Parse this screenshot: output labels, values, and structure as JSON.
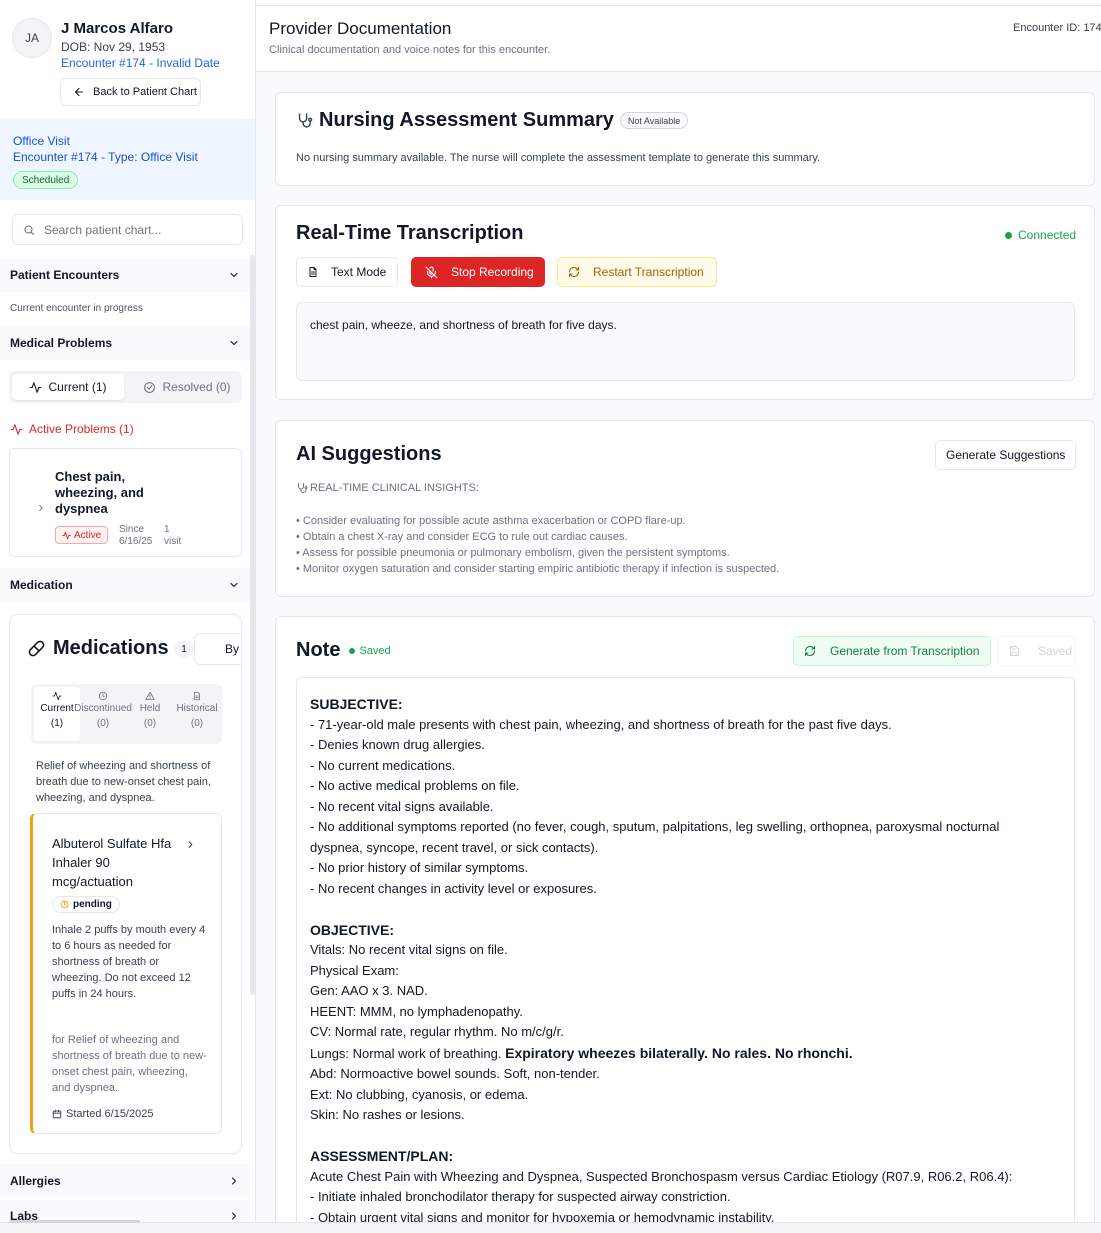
{
  "patient": {
    "initials": "JA",
    "name": "J Marcos Alfaro",
    "dob": "DOB: Nov 29, 1953",
    "encounter_link": "Encounter #174 - Invalid Date",
    "back_button": "Back to Patient Chart"
  },
  "visit": {
    "title": "Office Visit",
    "subtitle": "Encounter #174 - Type: Office Visit",
    "status": "Scheduled"
  },
  "search": {
    "placeholder": "Search patient chart..."
  },
  "sections": {
    "encounters": "Patient Encounters",
    "encounters_note": "Current encounter in progress",
    "problems": "Medical Problems",
    "medication": "Medication",
    "allergies": "Allergies",
    "labs": "Labs"
  },
  "problems": {
    "tab_current": "Current (1)",
    "tab_resolved": "Resolved (0)",
    "active_label": "Active Problems (1)",
    "item": {
      "title": "Chest pain, wheezing, and dyspnea",
      "status": "Active",
      "since_label": "Since",
      "since_date": "6/16/25",
      "visit_count": "1",
      "visit_label": "visit"
    }
  },
  "medications": {
    "title": "Medications",
    "count": "1",
    "group_button": "By M",
    "tabs": [
      {
        "label": "Current",
        "count": "(1)"
      },
      {
        "label": "Discontinued",
        "count": "(0)"
      },
      {
        "label": "Held",
        "count": "(0)"
      },
      {
        "label": "Historical",
        "count": "(0)"
      }
    ],
    "reason": "Relief of wheezing and shortness of breath due to new-onset chest pain, wheezing, and dyspnea.",
    "item": {
      "name": "Albuterol Sulfate Hfa Inhaler 90 mcg/actuation",
      "status": "pending",
      "sig": "Inhale 2 puffs by mouth every 4 to 6 hours as needed for shortness of breath or wheezing. Do not exceed 12 puffs in 24 hours.",
      "indication": "for Relief of wheezing and shortness of breath due to new-onset chest pain, wheezing, and dyspnea.",
      "started": "Started 6/15/2025"
    }
  },
  "header": {
    "title": "Provider Documentation",
    "subtitle": "Clinical documentation and voice notes for this encounter.",
    "encounter_id": "Encounter ID: 174"
  },
  "nursing": {
    "title": "Nursing Assessment Summary",
    "badge": "Not Available",
    "text": "No nursing summary available. The nurse will complete the assessment template to generate this summary."
  },
  "transcription": {
    "title": "Real-Time Transcription",
    "status": "Connected",
    "text_mode": "Text Mode",
    "stop": "Stop Recording",
    "restart": "Restart Transcription",
    "content": "chest pain, wheeze, and shortness of breath for five days."
  },
  "ai": {
    "title": "AI Suggestions",
    "button": "Generate Suggestions",
    "insights_header": "REAL-TIME CLINICAL INSIGHTS:",
    "items": [
      "• Consider evaluating for possible acute asthma exacerbation or COPD flare-up.",
      "• Obtain a chest X-ray and consider ECG to rule out cardiac causes.",
      "• Assess for possible pneumonia or pulmonary embolism, given the persistent symptoms.",
      "• Monitor oxygen saturation and consider starting empiric antibiotic therapy if infection is suspected."
    ]
  },
  "note": {
    "title": "Note",
    "saved_tag": "Saved",
    "generate": "Generate from Transcription",
    "saved_btn": "Saved",
    "subjective_h": "SUBJECTIVE:",
    "subjective": [
      "- 71-year-old male presents with chest pain, wheezing, and shortness of breath for the past five days.",
      "- Denies known drug allergies.",
      "- No current medications.",
      "- No active medical problems on file.",
      "- No recent vital signs available.",
      "- No additional symptoms reported (no fever, cough, sputum, palpitations, leg swelling, orthopnea, paroxysmal nocturnal",
      "dyspnea, syncope, recent travel, or sick contacts).",
      "- No prior history of similar symptoms.",
      "- No recent changes in activity level or exposures."
    ],
    "objective_h": "OBJECTIVE:",
    "objective": [
      "Vitals: No recent vital signs on file.",
      "Physical Exam:",
      "Gen: AAO x 3. NAD.",
      "HEENT: MMM, no lymphadenopathy.",
      "CV: Normal rate, regular rhythm. No m/c/g/r."
    ],
    "lungs_prefix": "Lungs: Normal work of breathing. ",
    "lungs_bold": "Expiratory wheezes bilaterally. No rales. No rhonchi.",
    "objective2": [
      "Abd: Normoactive bowel sounds. Soft, non-tender.",
      "Ext: No clubbing, cyanosis, or edema.",
      "Skin: No rashes or lesions."
    ],
    "assessment_h": "ASSESSMENT/PLAN:",
    "assessment": [
      "Acute Chest Pain with Wheezing and Dyspnea, Suspected Bronchospasm versus Cardiac Etiology (R07.9, R06.2, R06.4):",
      "- Initiate inhaled bronchodilator therapy for suspected airway constriction.",
      "- Obtain urgent vital signs and monitor for hypoxemia or hemodynamic instability."
    ]
  }
}
